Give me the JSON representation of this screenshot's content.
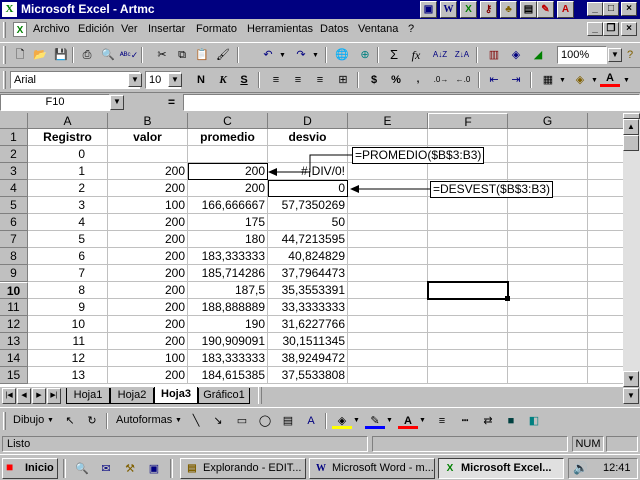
{
  "window": {
    "title": "Microsoft Excel - Artmc"
  },
  "menu": [
    "Archivo",
    "Edición",
    "Ver",
    "Insertar",
    "Formato",
    "Herramientas",
    "Datos",
    "Ventana",
    "?"
  ],
  "toolbar": {
    "zoom": "100%",
    "font": "Arial",
    "size": "10",
    "bold": "N",
    "italic": "K",
    "underline": "S",
    "currency": "$",
    "percent": "%",
    "sum": "Σ",
    "fx": "fx"
  },
  "formula_bar": {
    "name_box": "F10",
    "equals": "=",
    "content": ""
  },
  "columns": [
    "A",
    "B",
    "C",
    "D",
    "E",
    "F",
    "G"
  ],
  "rows": [
    {
      "n": "1",
      "a": "Registro",
      "b": "valor",
      "c": "promedio",
      "d": "desvio"
    },
    {
      "n": "2",
      "a": "0",
      "b": "",
      "c": "",
      "d": ""
    },
    {
      "n": "3",
      "a": "1",
      "b": "200",
      "c": "200",
      "d": "#¡DIV/0!"
    },
    {
      "n": "4",
      "a": "2",
      "b": "200",
      "c": "200",
      "d": "0"
    },
    {
      "n": "5",
      "a": "3",
      "b": "100",
      "c": "166,666667",
      "d": "57,7350269"
    },
    {
      "n": "6",
      "a": "4",
      "b": "200",
      "c": "175",
      "d": "50"
    },
    {
      "n": "7",
      "a": "5",
      "b": "200",
      "c": "180",
      "d": "44,7213595"
    },
    {
      "n": "8",
      "a": "6",
      "b": "200",
      "c": "183,333333",
      "d": "40,824829"
    },
    {
      "n": "9",
      "a": "7",
      "b": "200",
      "c": "185,714286",
      "d": "37,7964473"
    },
    {
      "n": "10",
      "a": "8",
      "b": "200",
      "c": "187,5",
      "d": "35,3553391"
    },
    {
      "n": "11",
      "a": "9",
      "b": "200",
      "c": "188,888889",
      "d": "33,3333333"
    },
    {
      "n": "12",
      "a": "10",
      "b": "200",
      "c": "190",
      "d": "31,6227766"
    },
    {
      "n": "13",
      "a": "11",
      "b": "200",
      "c": "190,909091",
      "d": "30,1511345"
    },
    {
      "n": "14",
      "a": "12",
      "b": "100",
      "c": "183,333333",
      "d": "38,9249472"
    },
    {
      "n": "15",
      "a": "13",
      "b": "200",
      "c": "184,615385",
      "d": "37,5533808"
    }
  ],
  "callouts": {
    "promedio": "=PROMEDIO($B$3:B3)",
    "desvest": "=DESVEST($B$3:B3)"
  },
  "sheet_tabs": [
    "Hoja1",
    "Hoja2",
    "Hoja3",
    "Gráfico1"
  ],
  "active_tab": "Hoja3",
  "draw_toolbar": {
    "dibujo": "Dibujo",
    "autoformas": "Autoformas"
  },
  "status": {
    "text": "Listo",
    "num": "NUM"
  },
  "taskbar": {
    "start": "Inicio",
    "tasks": [
      "Explorando - EDIT...",
      "Microsoft Word - m...",
      "Microsoft Excel..."
    ],
    "clock": "12:41"
  },
  "colors": {
    "title_bar": "#000080",
    "chrome": "#c0c0c0"
  }
}
